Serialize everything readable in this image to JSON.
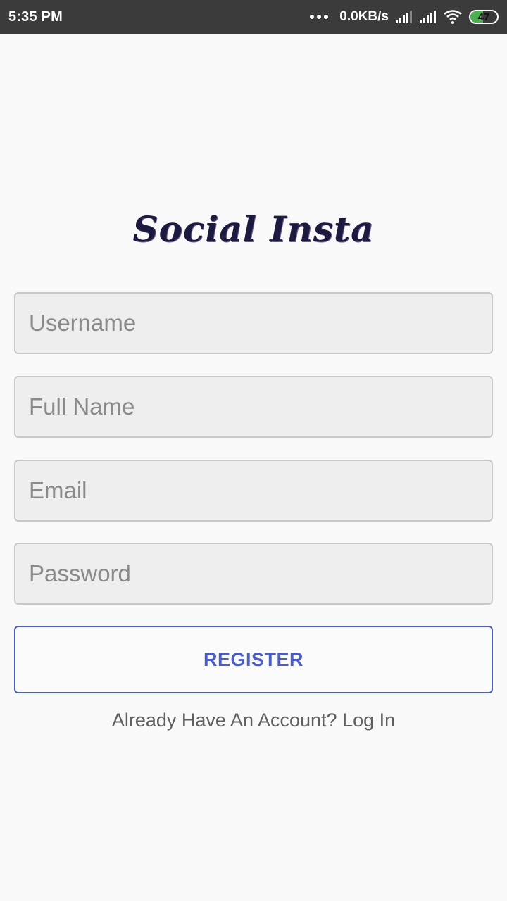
{
  "status_bar": {
    "time": "5:35 PM",
    "net_speed": "0.0KB/s",
    "battery_level": "47",
    "icons": [
      "more-dots-icon",
      "signal-icon",
      "signal-icon",
      "wifi-icon",
      "battery-icon"
    ]
  },
  "app": {
    "logo_text": "Social Insta"
  },
  "form": {
    "username_placeholder": "Username",
    "fullname_placeholder": "Full Name",
    "email_placeholder": "Email",
    "password_placeholder": "Password",
    "register_label": "REGISTER",
    "login_prompt": "Already Have An Account? Log In"
  },
  "colors": {
    "status_bar": "#3b3b3b",
    "background": "#f9f9f9",
    "accent": "#4a5cc7",
    "field_bg": "#eeeeee",
    "battery_green": "#4caf50"
  }
}
